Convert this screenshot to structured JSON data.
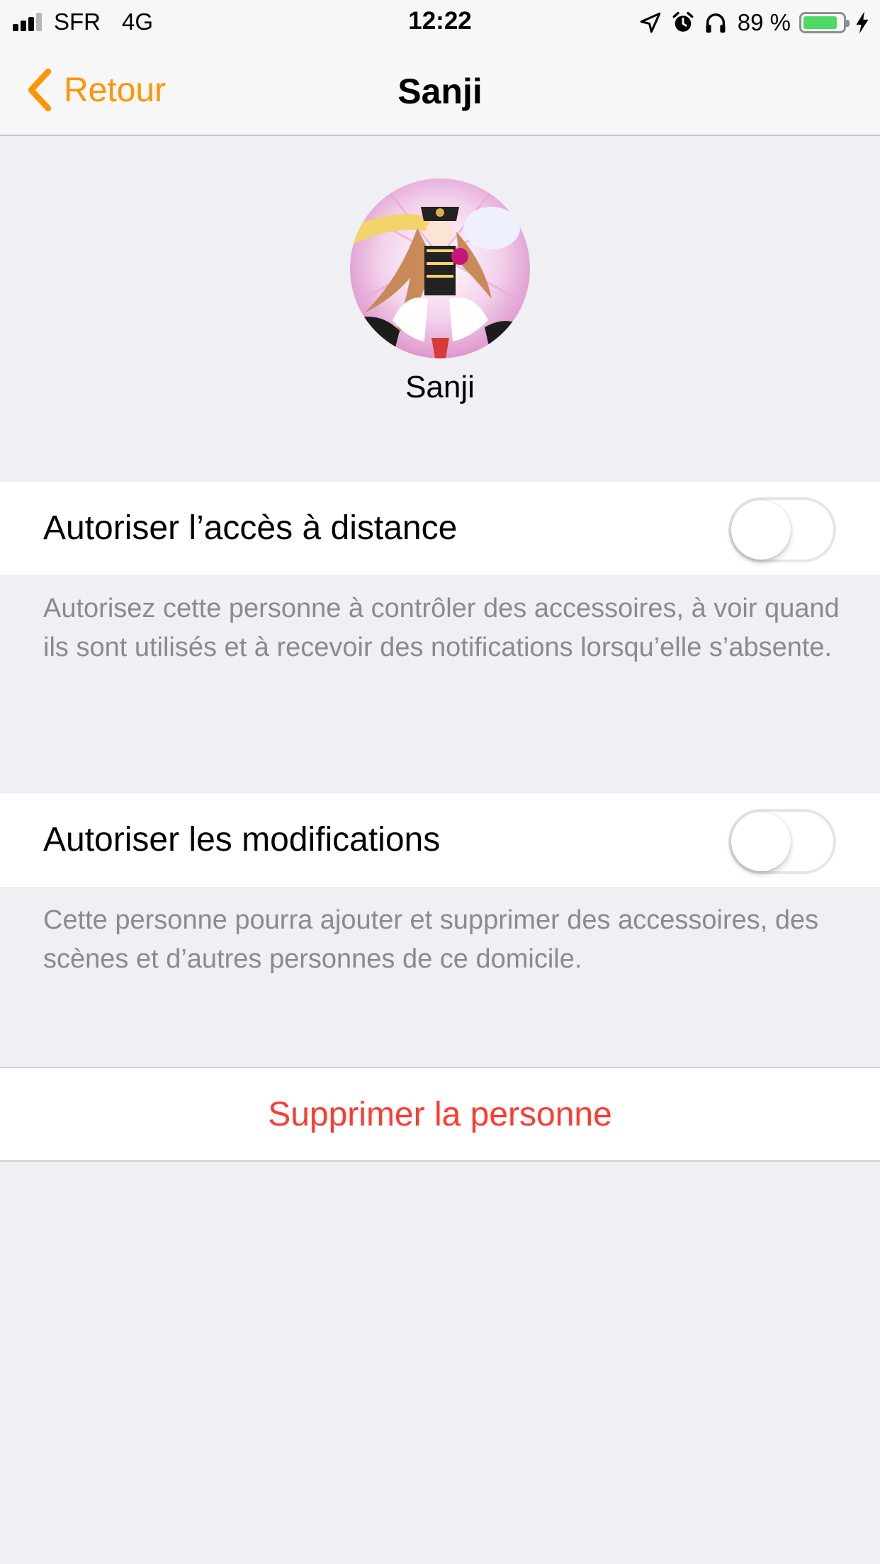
{
  "status_bar": {
    "carrier": "SFR",
    "network": "4G",
    "time": "12:22",
    "battery_percent": "89 %",
    "battery_level": 0.89,
    "icons": [
      "location-arrow-icon",
      "alarm-clock-icon",
      "headphones-icon",
      "battery-icon",
      "charging-bolt-icon"
    ]
  },
  "nav": {
    "back_label": "Retour",
    "title": "Sanji"
  },
  "profile": {
    "name": "Sanji"
  },
  "settings": {
    "remote_access": {
      "label": "Autoriser l’accès à distance",
      "enabled": false,
      "footer": "Autorisez cette personne à contrôler des accessoires, à voir quand ils sont utilisés et à recevoir des notifications lorsqu’elle s’absente."
    },
    "allow_edit": {
      "label": "Autoriser les modifications",
      "enabled": false,
      "footer": "Cette personne pourra ajouter et supprimer des accessoires, des scènes et d’autres personnes de ce domicile."
    }
  },
  "delete": {
    "label": "Supprimer la personne"
  },
  "colors": {
    "accent": "#ff9500",
    "destructive": "#ff3b30",
    "background": "#efeff4",
    "footer_text": "#8a8a8f",
    "battery_green": "#4cd964"
  }
}
